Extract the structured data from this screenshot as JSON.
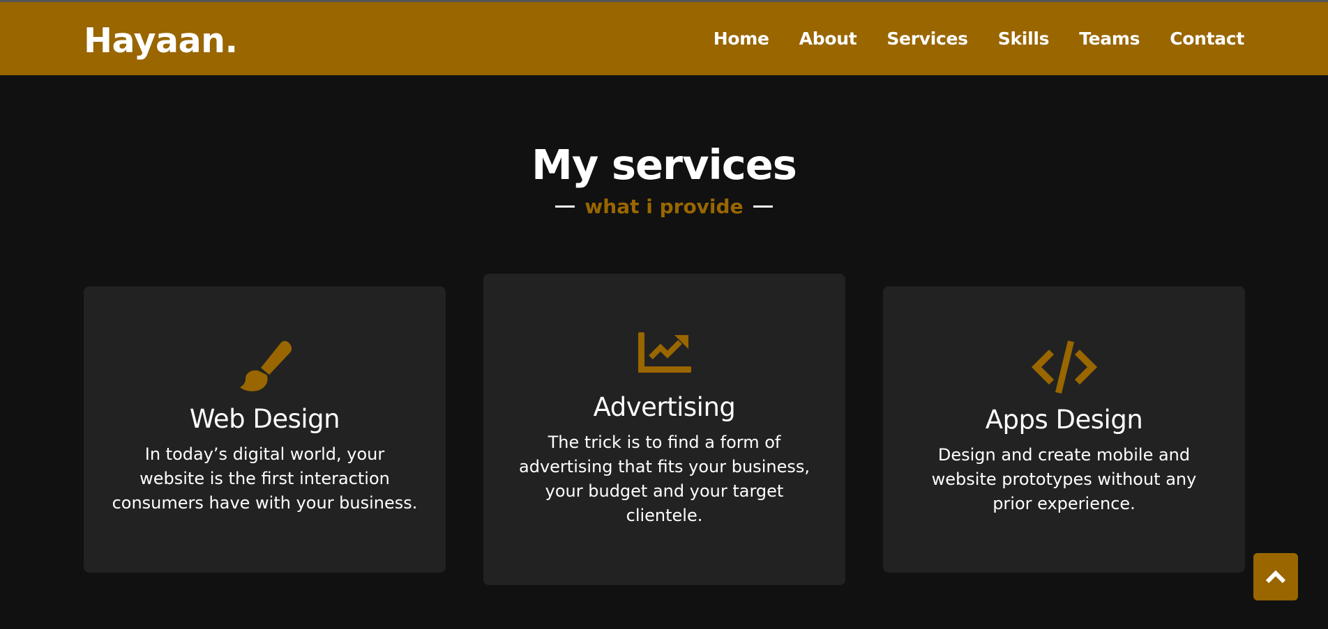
{
  "header": {
    "logo": "Hayaan.",
    "nav": [
      {
        "label": "Home"
      },
      {
        "label": "About"
      },
      {
        "label": "Services"
      },
      {
        "label": "Skills"
      },
      {
        "label": "Teams"
      },
      {
        "label": "Contact"
      }
    ]
  },
  "services": {
    "title": "My services",
    "subtitle": "what i provide",
    "cards": [
      {
        "icon": "paint-brush-icon",
        "title": "Web Design",
        "text": "In today’s digital world, your website is the first interaction consumers have with your business."
      },
      {
        "icon": "chart-line-icon",
        "title": "Advertising",
        "text": "The trick is to find a form of advertising that fits your business, your budget and your target clientele."
      },
      {
        "icon": "code-icon",
        "title": "Apps Design",
        "text": "Design and create mobile and website prototypes without any prior experience."
      }
    ]
  },
  "scroll_top": {
    "icon": "chevron-up-icon"
  },
  "colors": {
    "accent": "#996600",
    "background": "#111111",
    "card": "#222222",
    "text": "#ffffff"
  }
}
